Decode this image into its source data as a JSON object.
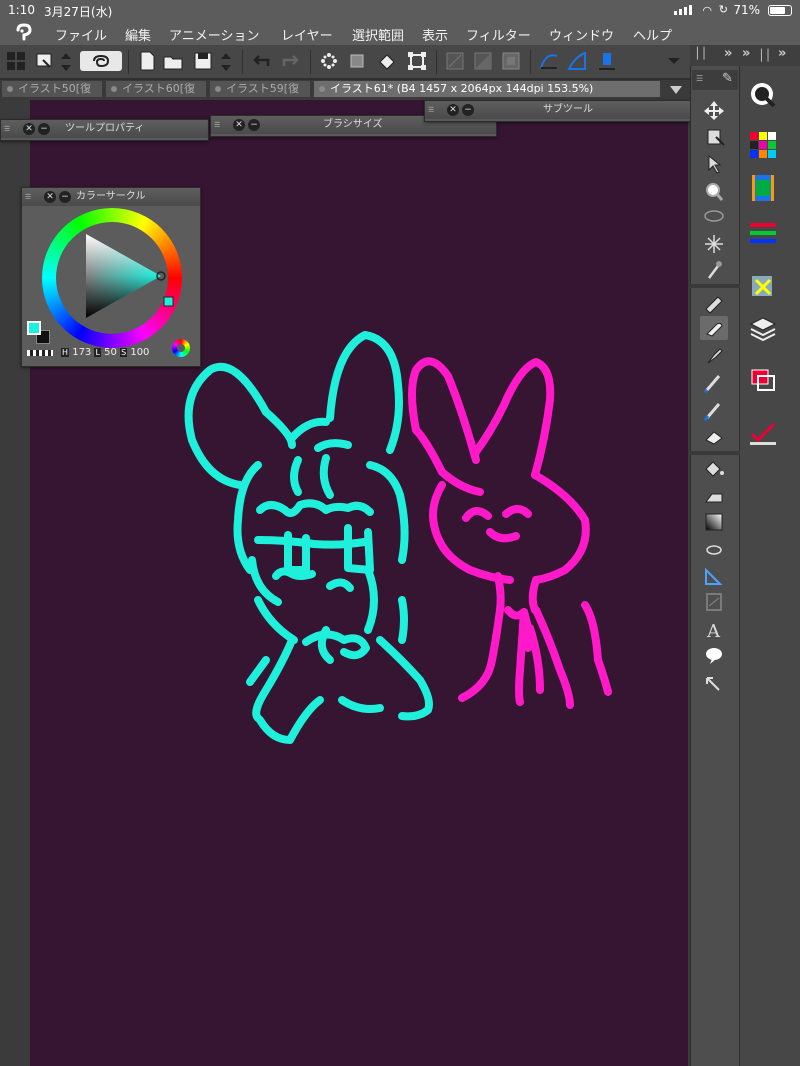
{
  "status_bar": {
    "time": "1:10",
    "date": "3月27日(水)",
    "battery": "71%"
  },
  "menu": {
    "items": [
      "ファイル",
      "編集",
      "アニメーション",
      "レイヤー",
      "選択範囲",
      "表示",
      "フィルター",
      "ウィンドウ",
      "ヘルプ"
    ]
  },
  "tabs": [
    {
      "label": "イラスト50[復"
    },
    {
      "label": "イラスト60[復"
    },
    {
      "label": "イラスト59[復"
    },
    {
      "label": "イラスト61* (B4 1457 x 2064px 144dpi 153.5%)"
    }
  ],
  "panels": {
    "tool_property": "ツールプロパティ",
    "brush_size": "ブラシサイズ",
    "sub_tool": "サブツール",
    "color_circle": {
      "title": "カラーサークル",
      "h_label": "H",
      "h_value": "173",
      "l_label": "L",
      "l_value": "50",
      "s_label": "S",
      "s_value": "100"
    }
  },
  "colors": {
    "canvas": "#351532",
    "current_color": "#19f2df",
    "cyan_stroke": "#1ef0dc",
    "magenta_stroke": "#ff19c8"
  },
  "toolbox_tools": [
    "move-layer",
    "operation",
    "zoom",
    "lasso-select",
    "auto-select",
    "eyedropper",
    "pen",
    "pencil",
    "brush",
    "airbrush",
    "decoration",
    "eraser",
    "fill",
    "blend",
    "gradient",
    "figure",
    "ruler",
    "frame",
    "text",
    "balloon",
    "correct-line"
  ],
  "side_palettes": [
    "navigator",
    "color-set",
    "animation-timeline",
    "color-slider",
    "material",
    "layer",
    "layer-property",
    "auto-action"
  ]
}
